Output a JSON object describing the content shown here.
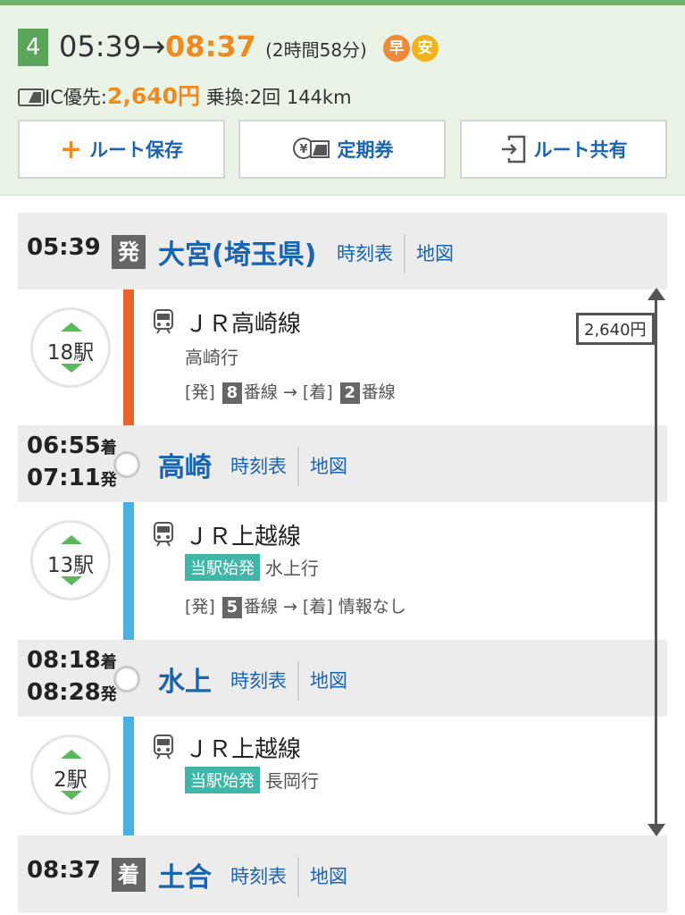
{
  "route": {
    "number": "4",
    "depart_time": "05:39",
    "arrow": "→",
    "arrive_time": "08:37",
    "duration": "(2時間58分)",
    "badge_fast": "早",
    "badge_cheap": "安",
    "ic_label": "IC優先:",
    "fare": "2,640円",
    "transfer": "乗換:2回",
    "distance": "144km"
  },
  "buttons": {
    "save": "ルート保存",
    "pass": "定期券",
    "share": "ルート共有"
  },
  "links": {
    "timetable": "時刻表",
    "map": "地図"
  },
  "stations": [
    {
      "tag": "発",
      "time": "05:39",
      "name": "大宮(埼玉県)"
    },
    {
      "arr": "06:55",
      "arr_label": "着",
      "dep": "07:11",
      "dep_label": "発",
      "name": "高崎"
    },
    {
      "arr": "08:18",
      "arr_label": "着",
      "dep": "08:28",
      "dep_label": "発",
      "name": "水上"
    },
    {
      "tag": "着",
      "time": "08:37",
      "name": "土合"
    }
  ],
  "segments": [
    {
      "stops": "18駅",
      "line": "ＪＲ高崎線",
      "dest": "高崎行",
      "dep_label": "[発]",
      "dep_platform": "8",
      "platform_suffix": "番線",
      "arrow": "→",
      "arr_label": "[着]",
      "arr_platform": "2",
      "arr_suffix": "番線",
      "color": "#e8622a"
    },
    {
      "stops": "13駅",
      "line": "ＪＲ上越線",
      "origin_tag": "当駅始発",
      "dest": "水上行",
      "dep_label": "[発]",
      "dep_platform": "5",
      "platform_suffix": "番線",
      "arrow": "→",
      "arr_label": "[着]",
      "arr_info": "情報なし",
      "color": "#4ab0e0"
    },
    {
      "stops": "2駅",
      "line": "ＪＲ上越線",
      "origin_tag": "当駅始発",
      "dest": "長岡行",
      "color": "#4ab0e0"
    }
  ],
  "fare_range_label": "2,640円"
}
